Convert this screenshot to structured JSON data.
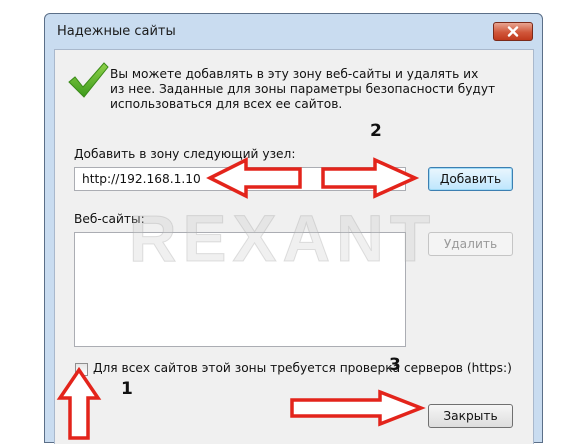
{
  "dialog": {
    "title": "Надежные сайты",
    "info_text": "Вы можете добавлять в эту зону  веб-сайты и удалять их\nиз нее. Заданные для зоны параметры безопасности будут\nиспользоваться для всех ее сайтов.",
    "add_label": "Добавить в зону следующий узел:",
    "url_value": "http://192.168.1.10",
    "add_button": "Добавить",
    "sites_label": "Веб-сайты:",
    "sites": [],
    "remove_button": "Удалить",
    "https_checkbox_label": "Для всех сайтов этой зоны требуется проверка серверов (https:)",
    "https_checked": false,
    "close_button": "Закрыть"
  },
  "annotations": {
    "step_1": "1",
    "step_2": "2",
    "step_3": "3",
    "arrow_color": "#e3241b"
  },
  "watermark": "REXANT"
}
